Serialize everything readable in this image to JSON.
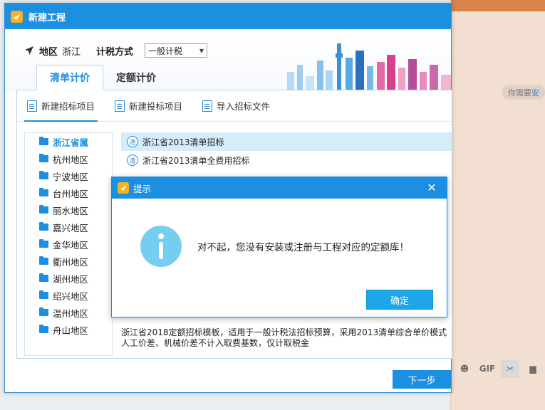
{
  "main_dialog": {
    "title": "新建工程",
    "region_label": "地区",
    "region_value": "浙江",
    "tax_label": "计税方式",
    "tax_value": "一般计税",
    "tabs": [
      {
        "label": "清单计价",
        "active": true
      },
      {
        "label": "定额计价",
        "active": false
      }
    ],
    "toolbar": [
      {
        "label": "新建招标项目",
        "active": true
      },
      {
        "label": "新建投标项目",
        "active": false
      },
      {
        "label": "导入招标文件",
        "active": false
      }
    ],
    "regions": [
      "浙江省属",
      "杭州地区",
      "宁波地区",
      "台州地区",
      "丽水地区",
      "嘉兴地区",
      "金华地区",
      "衢州地区",
      "湖州地区",
      "绍兴地区",
      "温州地区",
      "舟山地区"
    ],
    "selected_region": "浙江省属",
    "templates": [
      {
        "icon_text": "清",
        "label": "浙江省2013清单招标",
        "selected": true
      },
      {
        "icon_text": "清",
        "label": "浙江省2013清单全费用招标",
        "selected": false
      }
    ],
    "description_line1": "浙江省2018定额招标模板，适用于一般计税法招标预算，采用2013清单综合单价模式",
    "description_line2": "人工价差、机械价差不计入取费基数，仅计取税金",
    "next_button": "下一步"
  },
  "alert": {
    "title": "提示",
    "message": "对不起，您没有安装或注册与工程对应的定额库！",
    "ok_button": "确定"
  },
  "chat": {
    "bubble_prefix": "你需要",
    "bubble_highlight": "安",
    "tools": [
      {
        "name": "emoji-icon",
        "glyph": "☻"
      },
      {
        "name": "gif-icon",
        "glyph": "GIF"
      },
      {
        "name": "scissors-icon",
        "glyph": "✂"
      },
      {
        "name": "folder-icon",
        "glyph": "▆"
      }
    ]
  },
  "colors": {
    "accent": "#1d8fe0",
    "info": "#76cdf2",
    "ok_button": "#1ea7e8",
    "chat_bg": "#f3dfd2"
  }
}
